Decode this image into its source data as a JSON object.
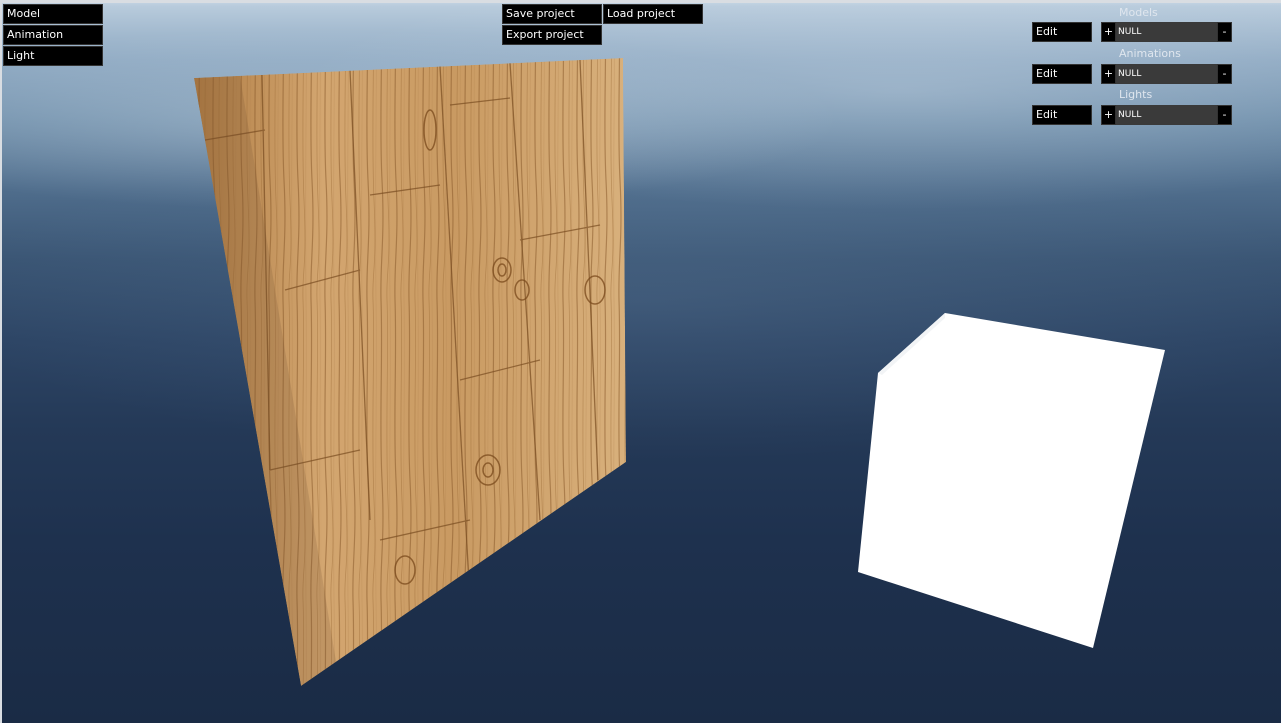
{
  "left_menu": {
    "items": [
      "Model",
      "Animation",
      "Light"
    ]
  },
  "project_menu": {
    "save": "Save project",
    "load": "Load project",
    "export": "Export project"
  },
  "right_panel": {
    "sections": [
      {
        "title": "Models",
        "edit": "Edit",
        "plus": "+",
        "value": "NULL",
        "minus": "-"
      },
      {
        "title": "Animations",
        "edit": "Edit",
        "plus": "+",
        "value": "NULL",
        "minus": "-"
      },
      {
        "title": "Lights",
        "edit": "Edit",
        "plus": "+",
        "value": "NULL",
        "minus": "-"
      }
    ]
  },
  "scene": {
    "objects": [
      "wood-textured-plane",
      "white-cube"
    ],
    "colors": {
      "wood_light": "#d9b07a",
      "wood_dark": "#8b5a2b",
      "cube": "#ffffff"
    }
  }
}
